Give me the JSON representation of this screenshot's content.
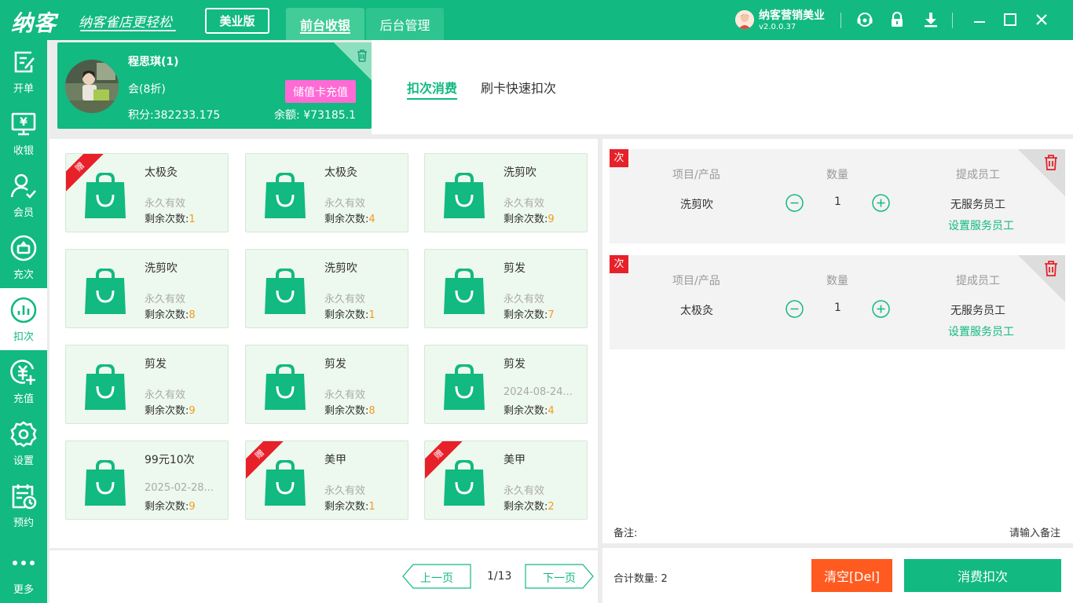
{
  "titlebar": {
    "logo": "纳客",
    "slogan": "纳客雀店更轻松",
    "edition": "美业版",
    "tabs": [
      "前台收银",
      "后台管理"
    ],
    "account": "纳客营销美业",
    "version": "v2.0.0.37",
    "icons": [
      "support-icon",
      "lock-icon",
      "download-icon",
      "minimize-icon",
      "maximize-icon",
      "close-icon"
    ]
  },
  "sidebar": {
    "items": [
      {
        "label": "开单",
        "icon": "order-icon"
      },
      {
        "label": "收银",
        "icon": "cashier-icon"
      },
      {
        "label": "会员",
        "icon": "member-icon"
      },
      {
        "label": "充次",
        "icon": "recharge-times-icon"
      },
      {
        "label": "扣次",
        "icon": "deduct-times-icon",
        "active": true
      },
      {
        "label": "充值",
        "icon": "recharge-icon"
      },
      {
        "label": "设置",
        "icon": "settings-icon"
      },
      {
        "label": "预约",
        "icon": "appointment-icon"
      },
      {
        "label": "更多",
        "icon": "more-icon"
      }
    ]
  },
  "member": {
    "name": "程思琪(1)",
    "level": "会(8折)",
    "recharge_button": "储值卡充值",
    "points": "积分:382233.175",
    "balance": "余额: ¥73185.1"
  },
  "mode_tabs": [
    "扣次消费",
    "刷卡快速扣次"
  ],
  "products": [
    {
      "name": "太极灸",
      "valid": "永久有效",
      "remaining_label": "剩余次数:",
      "remaining": "1",
      "gift": true
    },
    {
      "name": "太极灸",
      "valid": "永久有效",
      "remaining_label": "剩余次数:",
      "remaining": "4",
      "gift": false
    },
    {
      "name": "洗剪吹",
      "valid": "永久有效",
      "remaining_label": "剩余次数:",
      "remaining": "9",
      "gift": false
    },
    {
      "name": "洗剪吹",
      "valid": "永久有效",
      "remaining_label": "剩余次数:",
      "remaining": "8",
      "gift": false
    },
    {
      "name": "洗剪吹",
      "valid": "永久有效",
      "remaining_label": "剩余次数:",
      "remaining": "1",
      "gift": false
    },
    {
      "name": "剪发",
      "valid": "永久有效",
      "remaining_label": "剩余次数:",
      "remaining": "7",
      "gift": false
    },
    {
      "name": "剪发",
      "valid": "永久有效",
      "remaining_label": "剩余次数:",
      "remaining": "9",
      "gift": false
    },
    {
      "name": "剪发",
      "valid": "永久有效",
      "remaining_label": "剩余次数:",
      "remaining": "8",
      "gift": false
    },
    {
      "name": "剪发",
      "valid": "2024-08-24...",
      "remaining_label": "剩余次数:",
      "remaining": "4",
      "gift": false
    },
    {
      "name": "99元10次",
      "valid": "2025-02-28...",
      "remaining_label": "剩余次数:",
      "remaining": "9",
      "gift": false
    },
    {
      "name": "美甲",
      "valid": "永久有效",
      "remaining_label": "剩余次数:",
      "remaining": "1",
      "gift": true
    },
    {
      "name": "美甲",
      "valid": "永久有效",
      "remaining_label": "剩余次数:",
      "remaining": "2",
      "gift": true
    }
  ],
  "gift_label": "赠",
  "pager": {
    "prev": "上一页",
    "page": "1/13",
    "next": "下一页"
  },
  "cart": {
    "badge": "次",
    "headers": [
      "项目/产品",
      "数量",
      "提成员工"
    ],
    "items": [
      {
        "name": "洗剪吹",
        "qty": "1",
        "staff": "无服务员工",
        "set_staff": "设置服务员工"
      },
      {
        "name": "太极灸",
        "qty": "1",
        "staff": "无服务员工",
        "set_staff": "设置服务员工"
      }
    ],
    "remark_label": "备注:",
    "remark_placeholder": "请输入备注"
  },
  "footer": {
    "total": "合计数量: 2",
    "clear": "清空[Del]",
    "consume": "消费扣次"
  },
  "colors": {
    "primary": "#12b981",
    "accent_orange": "#f39a22",
    "danger": "#e8202a",
    "pink": "#ff6ad5",
    "clear_button": "#ff5a1f"
  }
}
